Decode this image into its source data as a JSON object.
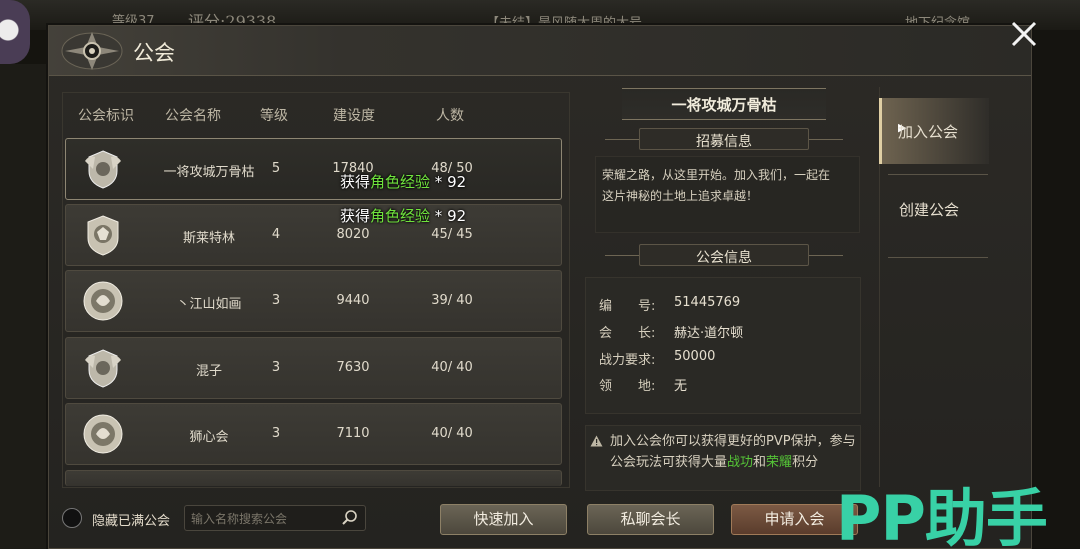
{
  "background": {
    "level_text": "等级37",
    "score_text": "评分:29338",
    "chat_text": "【未结】是风随太周的大号",
    "location_text": "地下纪念馆"
  },
  "panel": {
    "title": "公会",
    "close_icon": "close-icon"
  },
  "list": {
    "columns": [
      "公会标识",
      "公会名称",
      "等级",
      "建设度",
      "人数"
    ],
    "rows": [
      {
        "name": "一将攻城万骨枯",
        "level": "5",
        "build": "17840",
        "members": "48/ 50",
        "badge": "winged-shield-emblem",
        "selected": true
      },
      {
        "name": "斯莱特林",
        "level": "4",
        "build": "8020",
        "members": "45/ 45",
        "badge": "lion-crest-emblem",
        "selected": false
      },
      {
        "name": "丶江山如画",
        "level": "3",
        "build": "9440",
        "members": "39/ 40",
        "badge": "lion-circle-emblem",
        "selected": false
      },
      {
        "name": "混子",
        "level": "3",
        "build": "7630",
        "members": "40/ 40",
        "badge": "winged-shield-emblem",
        "selected": false
      },
      {
        "name": "狮心会",
        "level": "3",
        "build": "7110",
        "members": "40/ 40",
        "badge": "lion-circle-emblem",
        "selected": false
      }
    ]
  },
  "toasts": [
    {
      "prefix": "获得",
      "highlight": "角色经验",
      "suffix": " * 92"
    },
    {
      "prefix": "获得",
      "highlight": "角色经验",
      "suffix": " * 92"
    }
  ],
  "controls": {
    "hide_full_label": "隐藏已满公会",
    "search_placeholder": "输入名称搜索公会",
    "quick_join": "快速加入",
    "private_chat": "私聊会长",
    "apply_join": "申请入会"
  },
  "detail": {
    "guild_name": "一将攻城万骨枯",
    "recruit_title": "招募信息",
    "recruit_text": "荣耀之路，从这里开始。加入我们，一起在这片神秘的土地上追求卓越！",
    "info_title": "公会信息",
    "info": [
      {
        "label": "编　　号:",
        "value": "51445769"
      },
      {
        "label": "会　　长:",
        "value": "赫达·道尔顿"
      },
      {
        "label": "战力要求:",
        "value": "50000"
      },
      {
        "label": "领　　地:",
        "value": "无"
      }
    ],
    "tip_part1": "加入公会你可以获得更好的PVP保护，参与公会玩法可获得大量",
    "tip_hl1": "战功",
    "tip_mid": "和",
    "tip_hl2": "荣耀",
    "tip_end": "积分"
  },
  "tabs": {
    "join": "加入公会",
    "create": "创建公会"
  },
  "watermark": "PP助手",
  "colors": {
    "highlight_green": "#6fe23d",
    "tip_green": "#55c437",
    "watermark_teal": "#38d1a6"
  }
}
